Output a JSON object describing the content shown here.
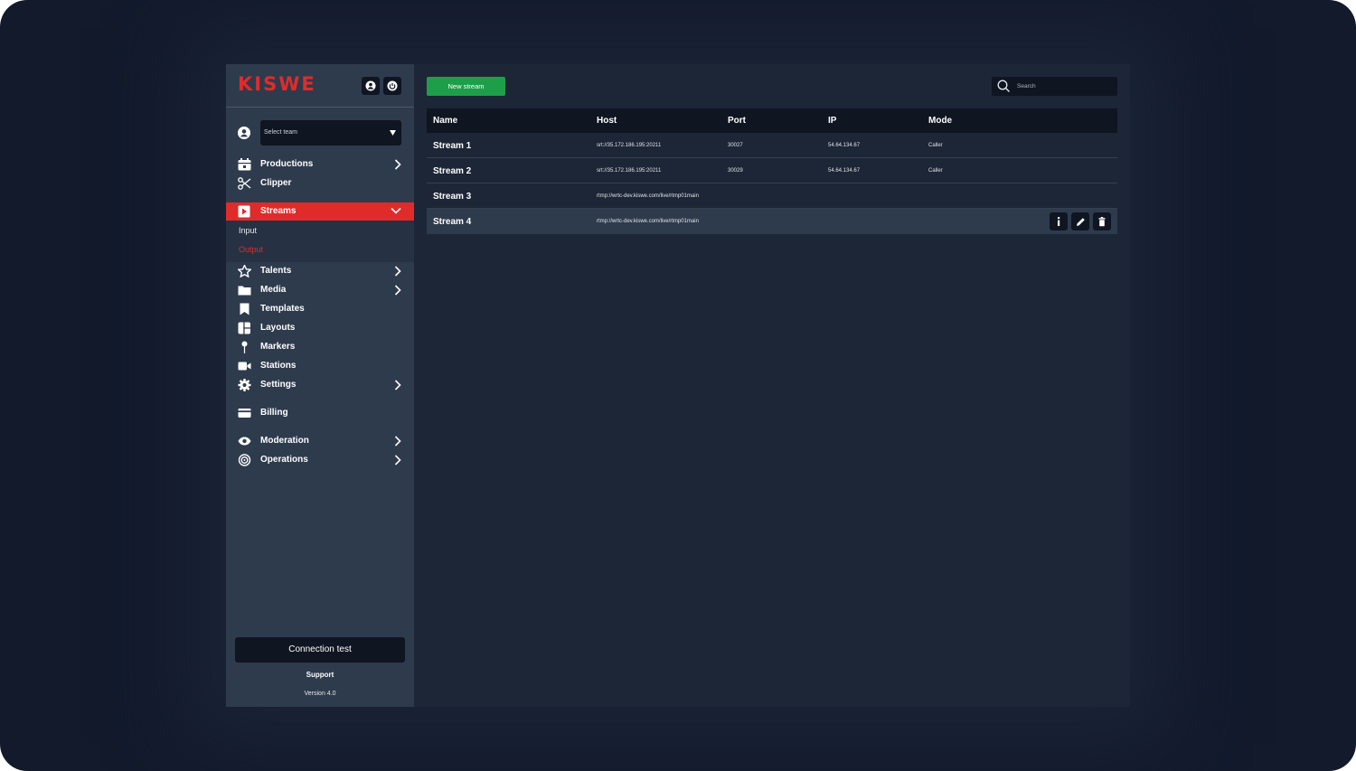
{
  "brand": {
    "logo": "KISWE",
    "accent": "#e02b2b"
  },
  "header": {
    "profile_icon": "user-icon",
    "power_icon": "power-icon"
  },
  "team": {
    "placeholder": "Select team"
  },
  "sidebar": {
    "items": [
      {
        "label": "Productions",
        "icon": "calendar-icon",
        "has_submenu": true
      },
      {
        "label": "Clipper",
        "icon": "scissors-icon",
        "has_submenu": false
      },
      {
        "label": "Streams",
        "icon": "play-icon",
        "has_submenu": true,
        "active": true,
        "children": [
          {
            "label": "Input"
          },
          {
            "label": "Output",
            "selected": true
          }
        ]
      },
      {
        "label": "Talents",
        "icon": "star-icon",
        "has_submenu": true
      },
      {
        "label": "Media",
        "icon": "folder-icon",
        "has_submenu": true
      },
      {
        "label": "Templates",
        "icon": "bookmark-icon",
        "has_submenu": false
      },
      {
        "label": "Layouts",
        "icon": "layout-icon",
        "has_submenu": false
      },
      {
        "label": "Markers",
        "icon": "pin-icon",
        "has_submenu": false
      },
      {
        "label": "Stations",
        "icon": "video-camera-icon",
        "has_submenu": false
      },
      {
        "label": "Settings",
        "icon": "gear-icon",
        "has_submenu": true
      },
      {
        "label": "Billing",
        "icon": "credit-card-icon",
        "has_submenu": false
      },
      {
        "label": "Moderation",
        "icon": "eye-icon",
        "has_submenu": true
      },
      {
        "label": "Operations",
        "icon": "cog-ring-icon",
        "has_submenu": true
      }
    ],
    "connection_test": "Connection test",
    "support": "Support",
    "version": "Version 4.0"
  },
  "toolbar": {
    "new_stream": "New stream",
    "search_placeholder": "Search"
  },
  "table": {
    "columns": [
      "Name",
      "Host",
      "Port",
      "IP",
      "Mode"
    ],
    "rows": [
      {
        "name": "Stream 1",
        "host": "srt://35.172.186.195:20211",
        "port": "30027",
        "ip": "54.64.134.67",
        "mode": "Caller"
      },
      {
        "name": "Stream 2",
        "host": "srt://35.172.186.195:20211",
        "port": "30029",
        "ip": "54.64.134.67",
        "mode": "Caller"
      },
      {
        "name": "Stream 3",
        "host": "rtmp://wrtc-dev.kiswe.com/live/rtmp01main",
        "port": "",
        "ip": "",
        "mode": ""
      },
      {
        "name": "Stream 4",
        "host": "rtmp://wrtc-dev.kiswe.com/live/rtmp01main",
        "port": "",
        "ip": "",
        "mode": "",
        "hovered": true
      }
    ],
    "row_actions": [
      "info-icon",
      "edit-pencil-icon",
      "trash-icon"
    ]
  }
}
